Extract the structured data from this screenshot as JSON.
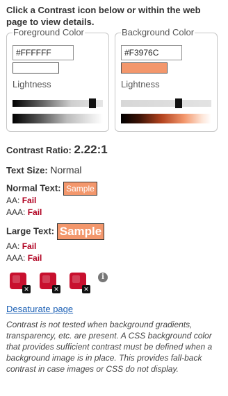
{
  "instructions": "Click a Contrast icon below or within the web page to view details.",
  "foreground": {
    "legend": "Foreground Color",
    "hex": "#FFFFFF",
    "swatch_color": "#FFFFFF",
    "lightness_label": "Lightness",
    "lightness_level": 0.92
  },
  "background": {
    "legend": "Background Color",
    "hex": "#F3976C",
    "swatch_color": "#F3976C",
    "lightness_label": "Lightness",
    "lightness_level": 0.65
  },
  "contrast": {
    "label": "Contrast Ratio:",
    "value": "2.22:1"
  },
  "text_size": {
    "label": "Text Size:",
    "value": "Normal"
  },
  "normal_text": {
    "label": "Normal Text:",
    "sample": "Sample",
    "aa_label": "AA:",
    "aa_result": "Fail",
    "aaa_label": "AAA:",
    "aaa_result": "Fail"
  },
  "large_text": {
    "label": "Large Text:",
    "sample": "Sample",
    "aa_label": "AA:",
    "aa_result": "Fail",
    "aaa_label": "AAA:",
    "aaa_result": "Fail"
  },
  "icons": [
    "contrast-error-icon",
    "contrast-error-icon",
    "contrast-error-icon"
  ],
  "info_icon_glyph": "i",
  "desaturate_link": "Desaturate page",
  "note": "Contrast is not tested when background gradients, transparency, etc. are present. A CSS background color that provides sufficient contrast must be defined when a background image is in place. This provides fall-back contrast in case images or CSS do not display.",
  "colors": {
    "fail": "#b00020",
    "icon_red": "#c8102e",
    "link": "#1a5fb4",
    "sample_bg": "#F3976C"
  }
}
